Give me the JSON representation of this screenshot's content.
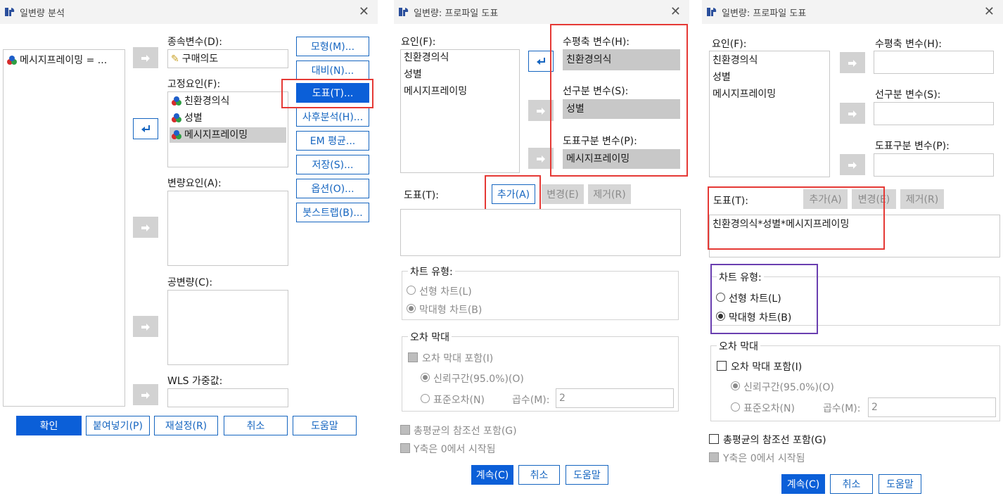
{
  "dialog1": {
    "title": "일변량 분석",
    "source_vars": [
      "메시지프레이밍 = ..."
    ],
    "dependent_label": "종속변수(D):",
    "dependent_value": "구매의도",
    "fixed_label": "고정요인(F):",
    "fixed_items": [
      "친환경의식",
      "성별",
      "메시지프레이밍"
    ],
    "random_label": "변량요인(A):",
    "covariate_label": "공변량(C):",
    "wls_label": "WLS 가중값:",
    "side_buttons": [
      "모형(M)...",
      "대비(N)...",
      "도표(T)...",
      "사후분석(H)...",
      "EM 평균...",
      "저장(S)...",
      "옵션(O)...",
      "붓스트랩(B)..."
    ],
    "bottom_buttons": [
      "확인",
      "붙여넣기(P)",
      "재설정(R)",
      "취소",
      "도움말"
    ]
  },
  "dialog2": {
    "title": "일변량: 프로파일 도표",
    "factors_label": "요인(F):",
    "factors": [
      "친환경의식",
      "성별",
      "메시지프레이밍"
    ],
    "horizontal_label": "수평축 변수(H):",
    "horizontal_value": "친환경의식",
    "separate_lines_label": "선구분 변수(S):",
    "separate_lines_value": "성별",
    "separate_plots_label": "도표구분 변수(P):",
    "separate_plots_value": "메시지프레이밍",
    "plots_label": "도표(T):",
    "add_btn": "추가(A)",
    "change_btn": "변경(E)",
    "remove_btn": "제거(R)",
    "chart_type_title": "차트 유형:",
    "line_chart": "선형 차트(L)",
    "bar_chart": "막대형 차트(B)",
    "error_bars_title": "오차 막대",
    "include_error_bars": "오차 막대 포함(I)",
    "ci": "신뢰구간(95.0%)(O)",
    "se": "표준오차(N)",
    "multiplier_label": "곱수(M):",
    "multiplier_value": "2",
    "ref_line": "총평균의 참조선 포함(G)",
    "y_axis_zero": "Y축은 0에서 시작됨",
    "continue_btn": "계속(C)",
    "cancel_btn": "취소",
    "help_btn": "도움말"
  },
  "dialog3": {
    "title": "일변량: 프로파일 도표",
    "factors_label": "요인(F):",
    "factors": [
      "친환경의식",
      "성별",
      "메시지프레이밍"
    ],
    "horizontal_label": "수평축 변수(H):",
    "separate_lines_label": "선구분 변수(S):",
    "separate_plots_label": "도표구분 변수(P):",
    "plots_label": "도표(T):",
    "add_btn": "추가(A)",
    "change_btn": "변경(E)",
    "remove_btn": "제거(R)",
    "plot_entry": "친환경의식*성별*메시지프레이밍",
    "chart_type_title": "차트 유형:",
    "line_chart": "선형 차트(L)",
    "bar_chart": "막대형 차트(B)",
    "error_bars_title": "오차 막대",
    "include_error_bars": "오차 막대 포함(I)",
    "ci": "신뢰구간(95.0%)(O)",
    "se": "표준오차(N)",
    "multiplier_label": "곱수(M):",
    "multiplier_value": "2",
    "ref_line": "총평균의 참조선 포함(G)",
    "y_axis_zero": "Y축은 0에서 시작됨",
    "continue_btn": "계속(C)",
    "cancel_btn": "취소",
    "help_btn": "도움말"
  },
  "colors": {
    "accent": "#0b5fd8",
    "highlight_red": "#e53935",
    "highlight_purple": "#6a3fb0"
  }
}
